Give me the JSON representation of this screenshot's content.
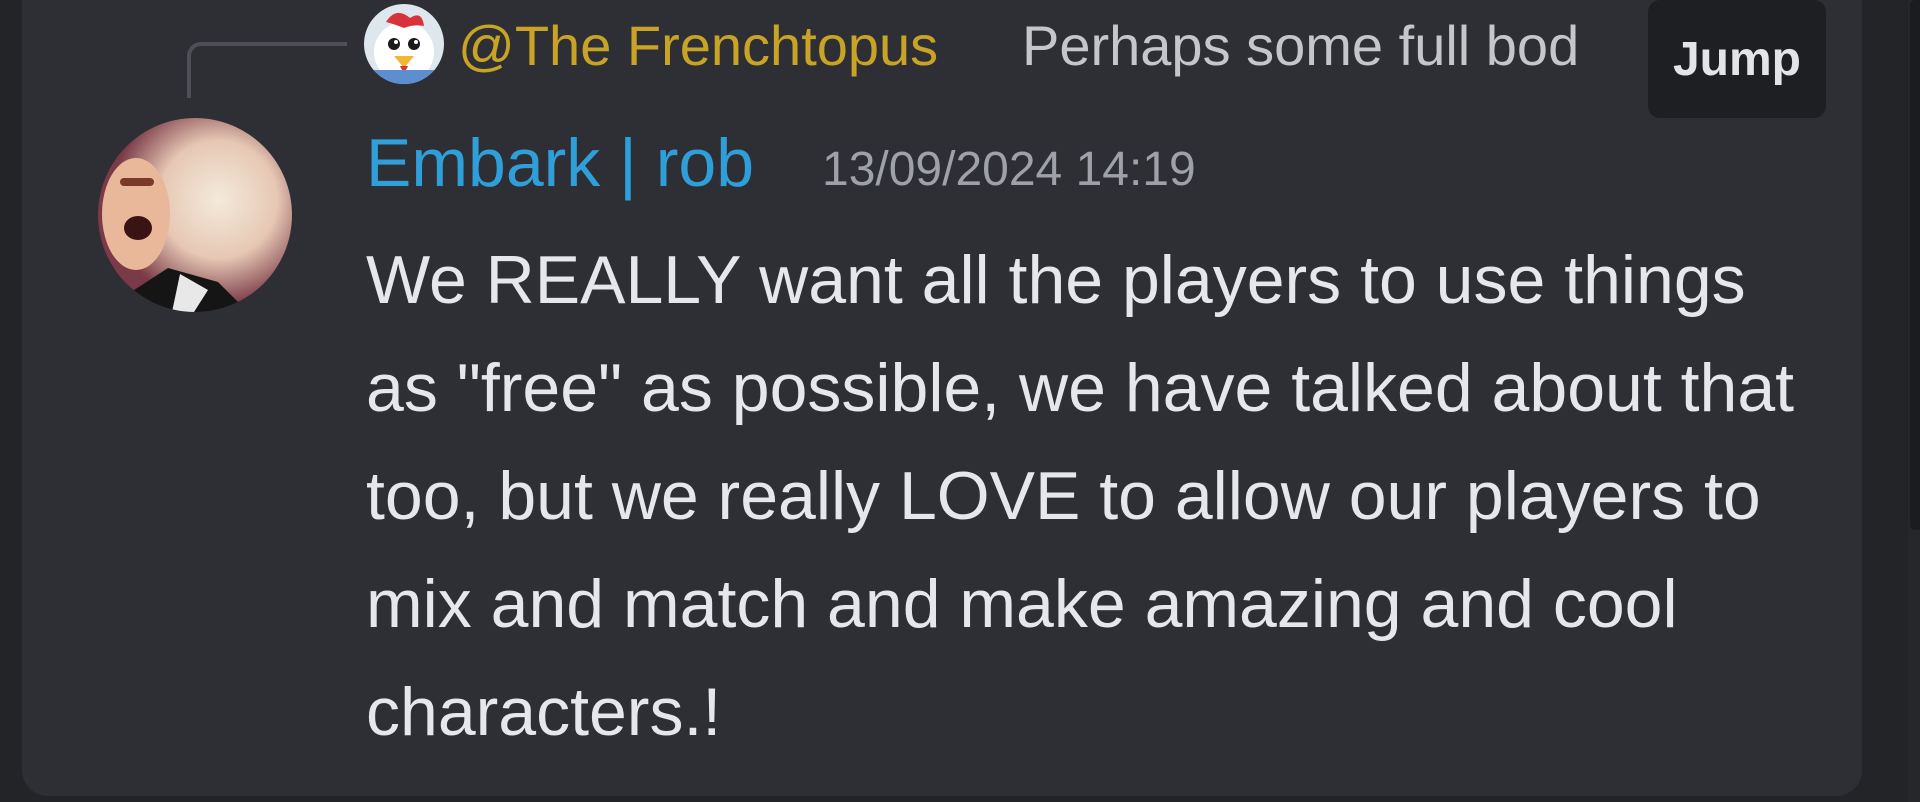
{
  "reply": {
    "author": "@The Frenchtopus",
    "preview": "Perhaps some full bod",
    "jump_label": "Jump"
  },
  "message": {
    "username": "Embark | rob",
    "timestamp": "13/09/2024 14:19",
    "content": "We REALLY want all the players to use things as \"free\" as possible, we have talked about that too, but we really LOVE to allow our players to mix and match and make amazing and cool characters.!"
  },
  "colors": {
    "reply_author": "#c8a326",
    "username": "#2e9fd8",
    "background": "#2e2f34"
  },
  "icons": {
    "reply_avatar": "chicken-avatar-icon",
    "user_avatar": "user-avatar-photo"
  }
}
